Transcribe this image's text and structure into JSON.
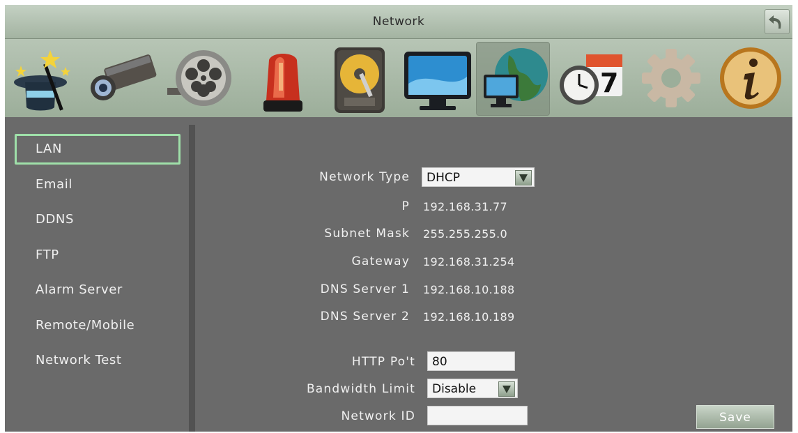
{
  "window": {
    "title": "Network"
  },
  "toolbar_icons": [
    {
      "name": "wizard-icon"
    },
    {
      "name": "camera-icon"
    },
    {
      "name": "film-reel-icon"
    },
    {
      "name": "alarm-siren-icon"
    },
    {
      "name": "hard-drive-icon"
    },
    {
      "name": "monitor-icon"
    },
    {
      "name": "network-globe-icon",
      "selected": true
    },
    {
      "name": "clock-calendar-icon"
    },
    {
      "name": "gear-icon"
    },
    {
      "name": "info-icon"
    }
  ],
  "sidebar": {
    "items": [
      {
        "label": "LAN",
        "active": true
      },
      {
        "label": "Email"
      },
      {
        "label": "DDNS"
      },
      {
        "label": "FTP"
      },
      {
        "label": "Alarm Server"
      },
      {
        "label": "Remote/Mobile"
      },
      {
        "label": "Network Test"
      }
    ]
  },
  "form": {
    "network_type": {
      "label": "Network Type",
      "value": "DHCP"
    },
    "ip": {
      "label": "P",
      "value": "192.168.31.77"
    },
    "subnet": {
      "label": "Subnet Mask",
      "value": "255.255.255.0"
    },
    "gateway": {
      "label": "Gateway",
      "value": "192.168.31.254"
    },
    "dns1": {
      "label": "DNS Server 1",
      "value": "192.168.10.188"
    },
    "dns2": {
      "label": "DNS Server 2",
      "value": "192.168.10.189"
    },
    "http_port": {
      "label": "HTTP Po't",
      "value": "80"
    },
    "bandwidth": {
      "label": "Bandwidth Limit",
      "value": "Disable"
    },
    "network_id": {
      "label": "Network ID",
      "value": ""
    }
  },
  "save_label": "Save",
  "calendar_day": "7",
  "colors": {
    "accent": "#9fe0a9",
    "panel": "#6a6a6a",
    "header": "#b0bfae"
  }
}
